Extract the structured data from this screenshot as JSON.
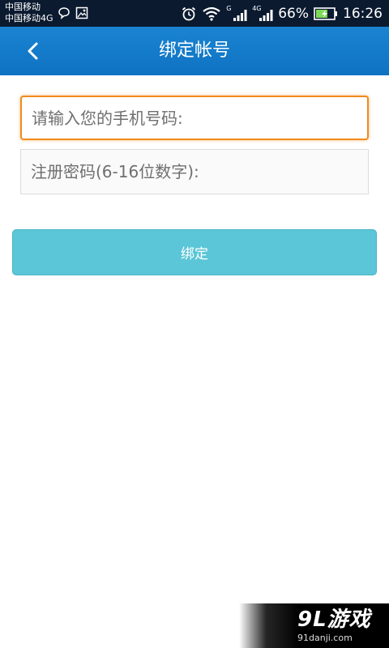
{
  "status_bar": {
    "carrier_1": "中国移动",
    "carrier_2": "中国移动4G",
    "sim1_label": "G",
    "sim2_label": "4G",
    "battery_percent": "66%",
    "time": "16:26",
    "battery_level": 0.66,
    "icons": [
      "chat-bubble-icon",
      "image-icon",
      "alarm-icon",
      "wifi-icon",
      "signal-icon",
      "battery-charging-icon"
    ]
  },
  "header": {
    "title": "绑定帐号",
    "back_icon": "chevron-left-icon"
  },
  "form": {
    "phone_placeholder": "请输入您的手机号码:",
    "phone_value": "",
    "password_placeholder": "注册密码(6-16位数字):",
    "password_value": "",
    "bind_button_label": "绑定"
  },
  "watermark": {
    "logo": "9L游戏",
    "url": "91danji.com"
  },
  "colors": {
    "status_bar_bg": "#0b1a2f",
    "header_bg": "#1a84d2",
    "focus_border": "#f08a1e",
    "button_bg": "#5bc6d7",
    "battery_fill": "#7ed957"
  }
}
